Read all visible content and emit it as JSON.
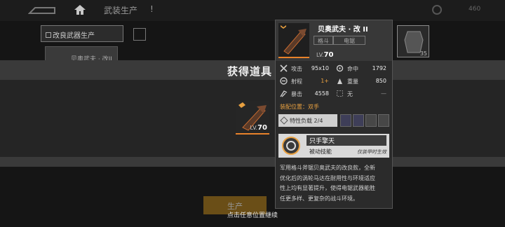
{
  "header": {
    "title": "武装生产",
    "alert": "!",
    "currency_value": "460"
  },
  "tab": {
    "label": "改良武器生产"
  },
  "bg_card": {
    "label": "贝奥武夫 · 改II"
  },
  "bg_thumb": {
    "level": "35"
  },
  "modal": {
    "title": "获得道具",
    "item_level_prefix": "LV.",
    "item_level": "70",
    "produce_label": "生产",
    "continue_hint": "点击任意位置继续"
  },
  "detail": {
    "name": "贝奥武夫 · 改 II",
    "tag1": "格斗",
    "tag2": "电锯",
    "level_prefix": "LV.",
    "level": "70",
    "stats": [
      {
        "icon": "crossed-swords-icon",
        "label": "攻击",
        "value": "95x10",
        "col": 0,
        "row": 0,
        "color": "#eeeeee"
      },
      {
        "icon": "crosshair-icon",
        "label": "命中",
        "value": "1792",
        "col": 1,
        "row": 0,
        "color": "#eeeeee"
      },
      {
        "icon": "range-icon",
        "label": "射程",
        "value": "1+",
        "col": 0,
        "row": 1,
        "color": "#e8a040"
      },
      {
        "icon": "weight-icon",
        "label": "重量",
        "value": "850",
        "col": 1,
        "row": 1,
        "color": "#eeeeee"
      },
      {
        "icon": "burst-icon",
        "label": "暴击",
        "value": "4558",
        "col": 0,
        "row": 2,
        "color": "#eeeeee"
      },
      {
        "icon": "null-icon",
        "label": "无",
        "value": "—",
        "col": 1,
        "row": 2,
        "color": "#999999"
      }
    ],
    "mount_label": "装配位置：双手",
    "trait_label": "特性负载 2/4",
    "skill": {
      "name": "只手擎天",
      "type": "被动技能",
      "note": "仅装甲时生效"
    },
    "description_lines": [
      "军用格斗斧锯贝奥武夫的改良款，全新",
      "优化后的涡轮马达在耐用性与环境适应",
      "性上均有显著提升，使得电锯武器能胜",
      "任更多样、更复杂的战斗环境。"
    ]
  },
  "colors": {
    "accent": "#e8822a",
    "highlight": "#e8a040",
    "panel": "#2b2b2b"
  }
}
